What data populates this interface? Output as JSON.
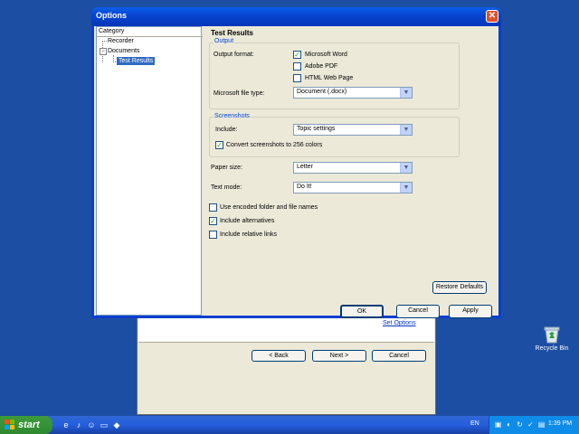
{
  "wizard": {
    "set_options_link": "Set Options",
    "back_label": "< Back",
    "next_label": "Next >",
    "cancel_label": "Cancel"
  },
  "desktop": {
    "recycle_bin_label": "Recycle Bin"
  },
  "dialog": {
    "title": "Options",
    "close_glyph": "✕",
    "category_header": "Category",
    "tree": {
      "recorder": "Recorder",
      "documents": "Documents",
      "test_results": "Test Results"
    },
    "heading": "Test Results",
    "output": {
      "group_label": "Output",
      "format_label": "Output format:",
      "formats": [
        {
          "label": "Microsoft Word",
          "checked": true
        },
        {
          "label": "Adobe PDF",
          "checked": false
        },
        {
          "label": "HTML Web Page",
          "checked": false
        }
      ],
      "file_type_label": "Microsoft file type:",
      "file_type_value": "Document (.docx)"
    },
    "screenshots": {
      "group_label": "Screenshots",
      "include_label": "Include:",
      "include_value": "Topic settings",
      "convert_label": "Convert screenshots to 256 colors",
      "convert_checked": true
    },
    "paper_size_label": "Paper size:",
    "paper_size_value": "Letter",
    "text_mode_label": "Text mode:",
    "text_mode_value": "Do It!",
    "options": [
      {
        "label": "Use encoded folder and file names",
        "checked": false
      },
      {
        "label": "Include alternatives",
        "checked": true
      },
      {
        "label": "Include relative links",
        "checked": false
      }
    ],
    "restore_defaults_label": "Restore Defaults",
    "ok_label": "OK",
    "cancel_label": "Cancel",
    "apply_label": "Apply"
  },
  "taskbar": {
    "start_label": "start",
    "language": "EN",
    "clock": "1:39 PM"
  },
  "colors": {
    "desktop": "#1c4ea3",
    "dialog_face": "#ece9d8",
    "selection": "#316ac5",
    "group_label": "#0046d5",
    "check": "#21a121"
  }
}
